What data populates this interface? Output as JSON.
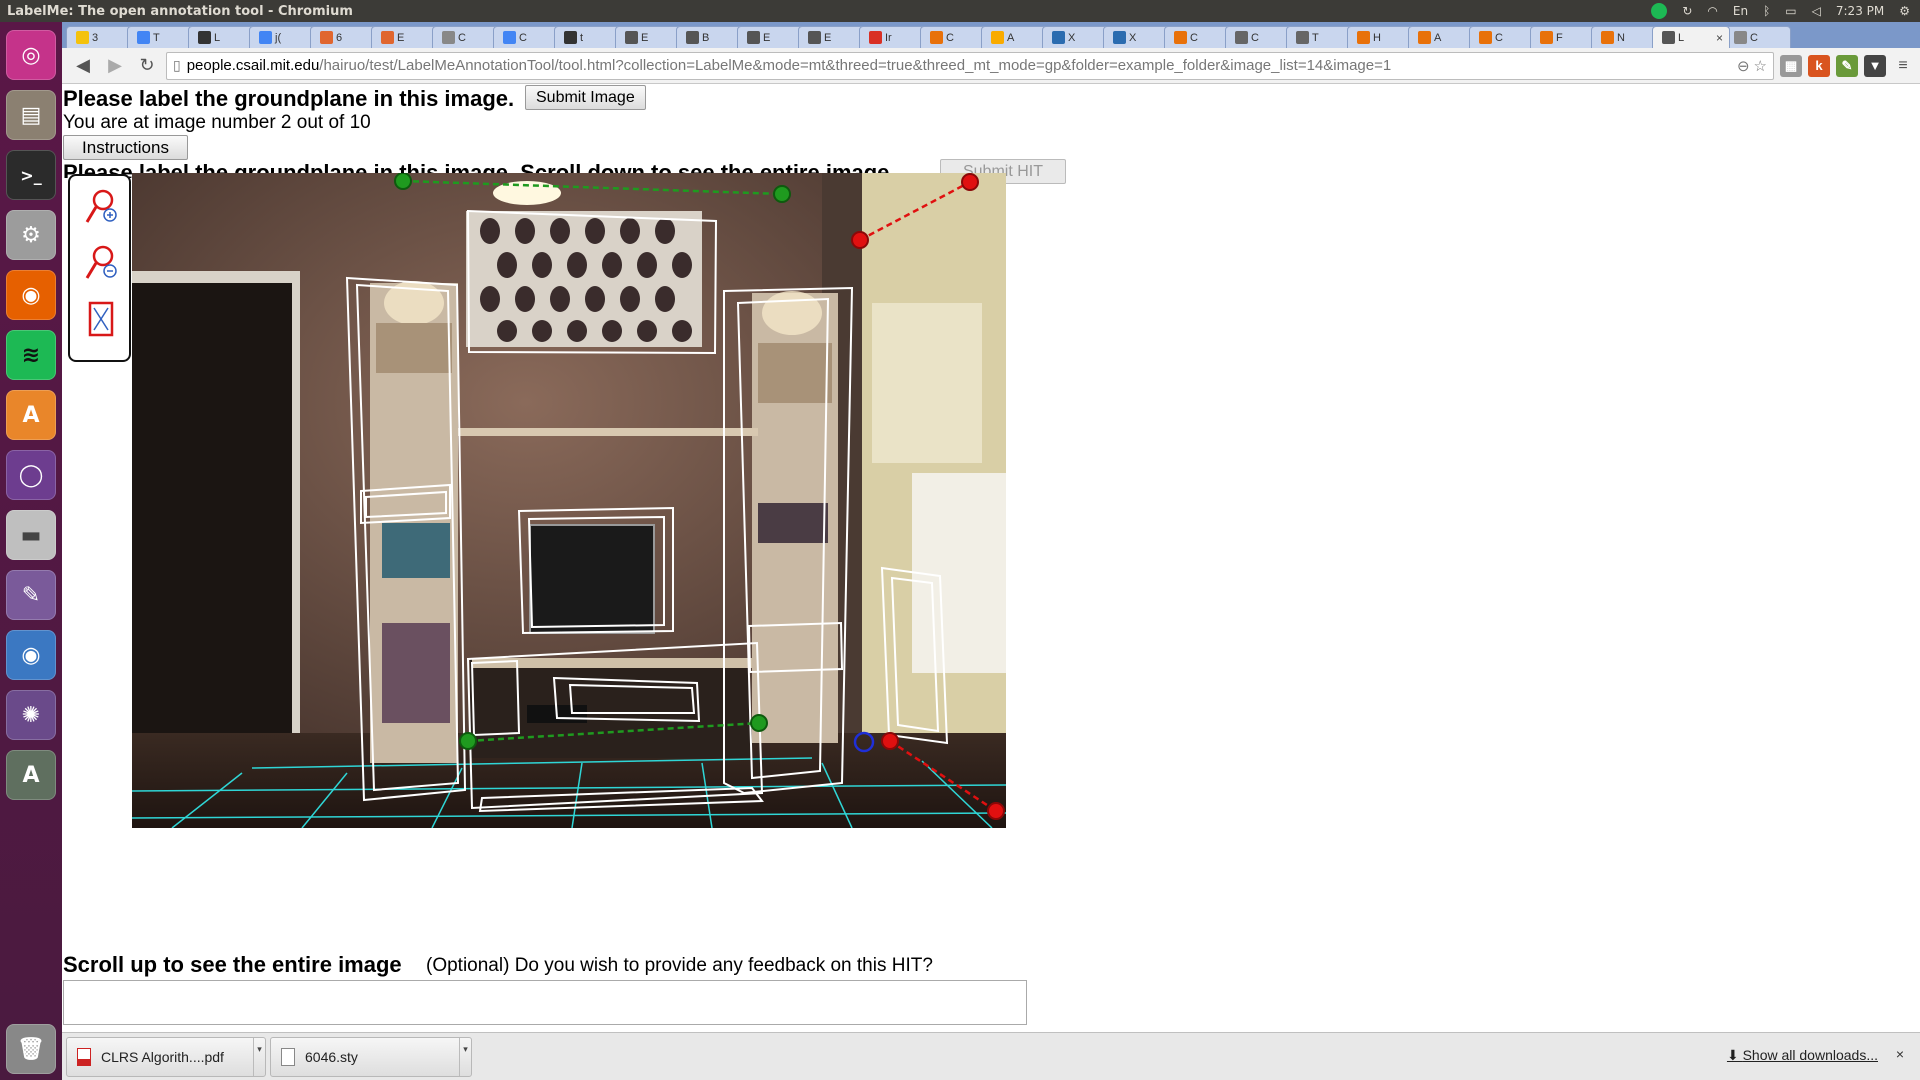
{
  "window_title": "LabelMe: The open annotation tool - Chromium",
  "tray": {
    "keyboard": "En",
    "clock": "7:23 PM"
  },
  "tabs": [
    {
      "label": "3",
      "color": "#f4c20d"
    },
    {
      "label": "T",
      "color": "#4285f4"
    },
    {
      "label": "L",
      "color": "#333333"
    },
    {
      "label": "j(",
      "color": "#4285f4"
    },
    {
      "label": "6",
      "color": "#e0662f"
    },
    {
      "label": "E",
      "color": "#e0662f"
    },
    {
      "label": "C",
      "color": "#888888"
    },
    {
      "label": "C",
      "color": "#4285f4"
    },
    {
      "label": "t",
      "color": "#333333"
    },
    {
      "label": "E",
      "color": "#555555"
    },
    {
      "label": "B",
      "color": "#555555"
    },
    {
      "label": "E",
      "color": "#555555"
    },
    {
      "label": "E",
      "color": "#555555"
    },
    {
      "label": "Ir",
      "color": "#d93025"
    },
    {
      "label": "C",
      "color": "#e8710a"
    },
    {
      "label": "A",
      "color": "#f9ab00"
    },
    {
      "label": "X",
      "color": "#2b6cb0"
    },
    {
      "label": "X",
      "color": "#2b6cb0"
    },
    {
      "label": "C",
      "color": "#e8710a"
    },
    {
      "label": "C",
      "color": "#666666"
    },
    {
      "label": "T",
      "color": "#666666"
    },
    {
      "label": "H",
      "color": "#e8710a"
    },
    {
      "label": "A",
      "color": "#e8710a"
    },
    {
      "label": "C",
      "color": "#e8710a"
    },
    {
      "label": "F",
      "color": "#e8710a"
    },
    {
      "label": "N",
      "color": "#e8710a"
    },
    {
      "label": "L",
      "color": "#555555",
      "active": true
    },
    {
      "label": "C",
      "color": "#888888"
    }
  ],
  "address": {
    "host": "people.csail.mit.edu",
    "path": "/hairuo/test/LabelMeAnnotationTool/tool.html?collection=LabelMe&mode=mt&threed=true&threed_mt_mode=gp&folder=example_folder&image_list=14&image=1"
  },
  "page": {
    "heading": "Please label the groundplane in this image.",
    "submit_image": "Submit Image",
    "image_counter": "You are at image number 2 out of 10",
    "instructions": "Instructions",
    "heading2": "Please label the groundplane in this image. Scroll down to see the entire image.",
    "submit_hit": "Submit HIT",
    "scroll_up": "Scroll up to see the entire image",
    "feedback_question": "(Optional) Do you wish to provide any feedback on this HIT?"
  },
  "zoom_tools": [
    "zoom-in",
    "zoom-out",
    "fit-image"
  ],
  "canvas_colors": {
    "vanishing_left": "#1f9a1f",
    "vanishing_right": "#e01010",
    "origin": "#1f2fd8",
    "grid": "#2fd6d6",
    "boxes": "#ffffff"
  },
  "downloads": [
    {
      "name": "CLRS Algorith....pdf",
      "type": "pdf"
    },
    {
      "name": "6046.sty",
      "type": "file"
    }
  ],
  "show_all_downloads": "Show all downloads...",
  "close_shelf": "×"
}
